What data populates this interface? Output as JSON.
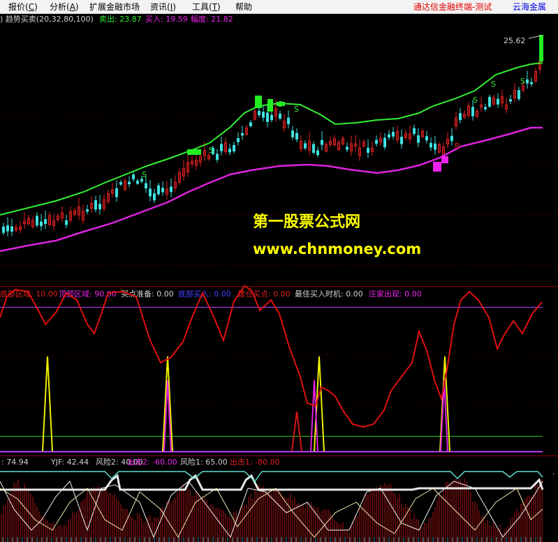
{
  "menu": {
    "items": [
      "报价(",
      "分析(",
      "扩展金融市场",
      "资讯(",
      "工具(",
      "帮助"
    ],
    "hotkeys": [
      "C",
      "A",
      "",
      "I",
      "T",
      ""
    ],
    "brand_red": "通达信金融终端-测试",
    "brand_blue": "云海金属"
  },
  "panel1": {
    "title": ") 趋势买卖(20,32,80,100)",
    "sell_label": "卖出: 23.87",
    "buy_label": "买入: 19.59",
    "range_label": "幅度: 21.82",
    "high_price": "25.62",
    "sell_marker": "S",
    "buy_marker": "B",
    "watermark_title": "第一股票公式网",
    "watermark_url": "www.chnmoney.com"
  },
  "panel2": {
    "labels": [
      "底部区域: 10.00",
      "顶部区域: 90.00",
      "买点准备: 0.00",
      "底部买入: 0.00",
      "建仓买点: 0.00",
      "最佳买入时机: 0.00",
      "庄家出现: 0.00"
    ]
  },
  "panel3": {
    "labels": [
      ": 74.94",
      "YJF: 42.44",
      "风险2: 40.00",
      "出击2: -60.00",
      "风险1: 65.00",
      "出击1: -80.00"
    ]
  },
  "colors": {
    "background": "#000000",
    "sell_line": "#33ee33",
    "buy_line": "#dd22dd",
    "up_candle": "#e02020",
    "down_candle": "#40e0e0",
    "signal_green": "#22ee22",
    "signal_magenta": "#ee22ee",
    "grid_red": "#8b0000",
    "oscillator": "#e01010",
    "spike_yellow": "#f0f000",
    "spike_magenta": "#e020e0",
    "level_green": "#22cc22",
    "level_purple": "#bb44ff",
    "watermark": "#ffff00"
  }
}
